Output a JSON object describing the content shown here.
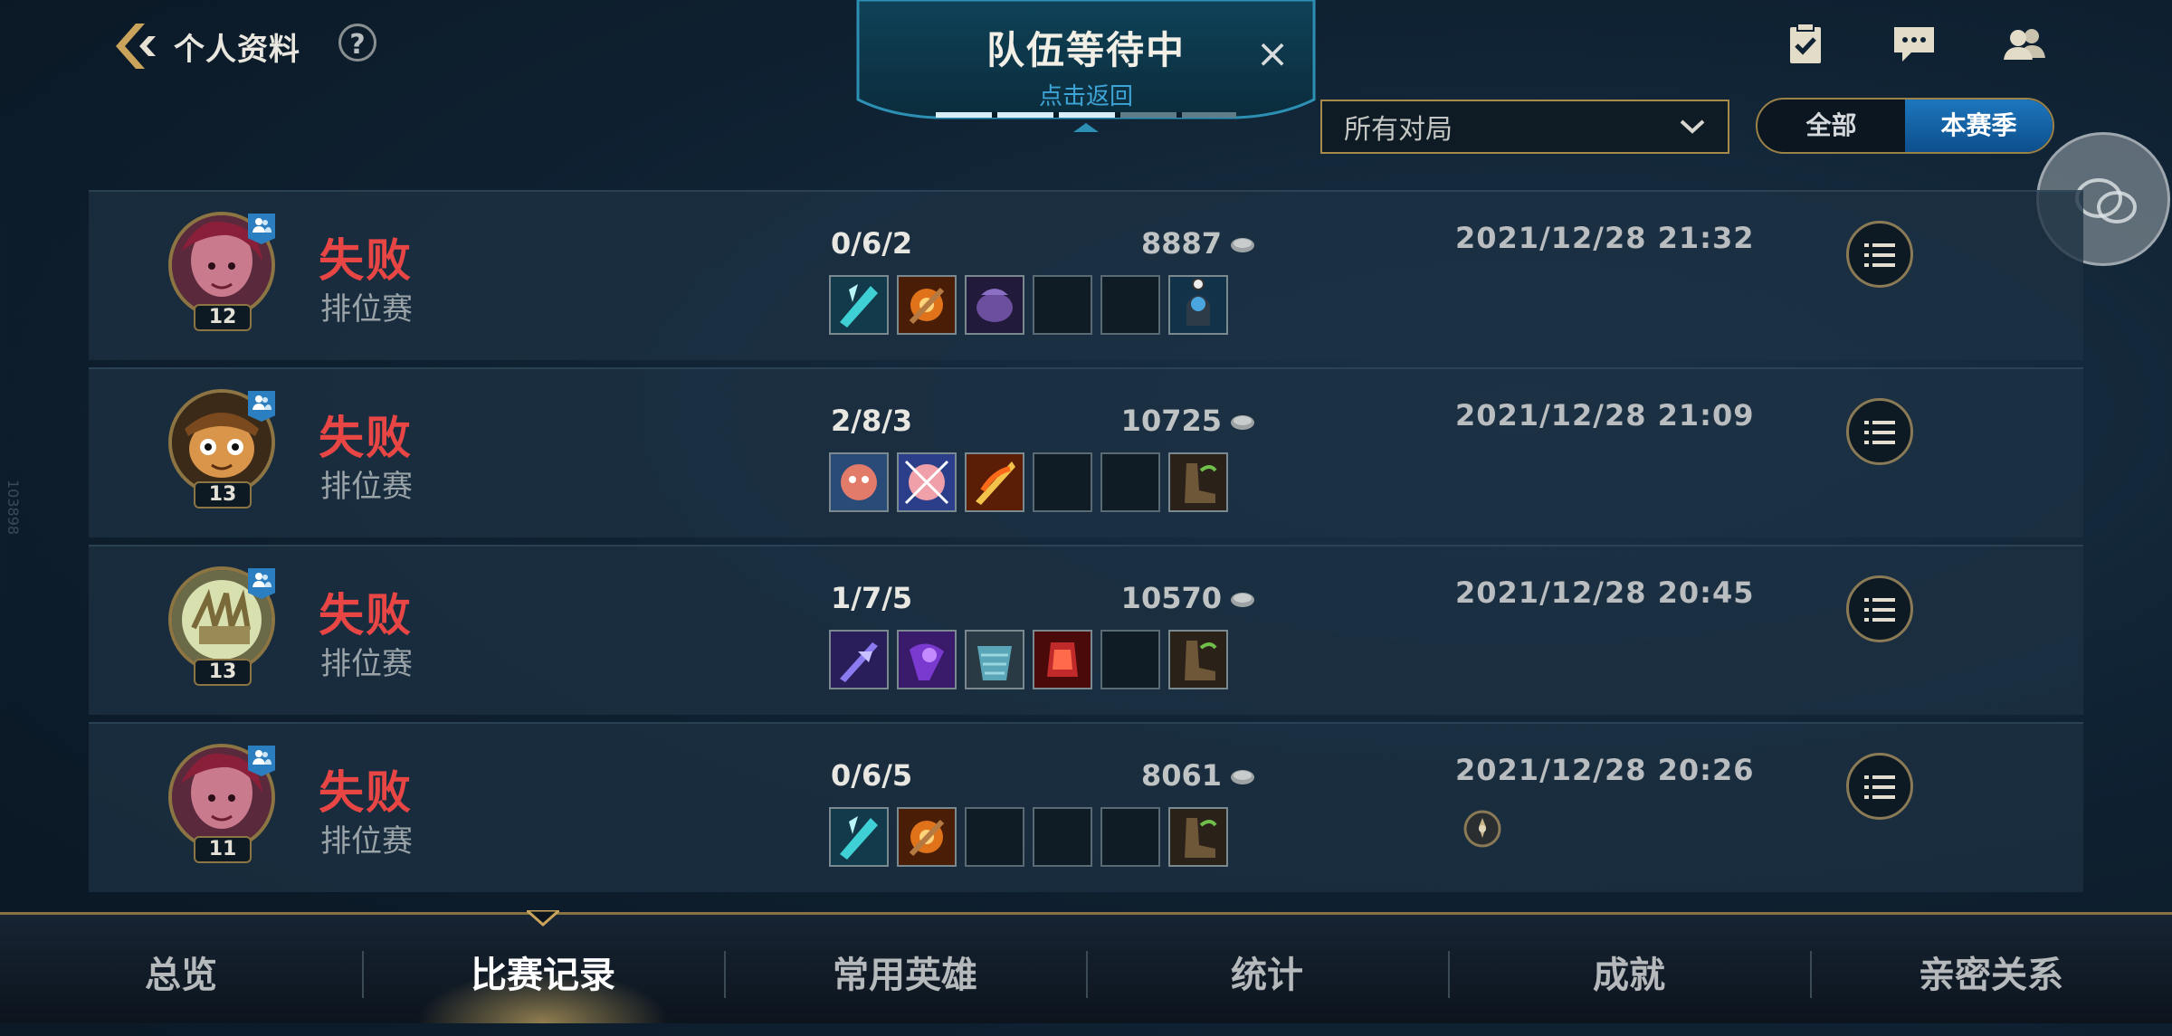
{
  "header": {
    "title": "个人资料",
    "help_icon": "?"
  },
  "queue_banner": {
    "title": "队伍等待中",
    "subtitle": "点击返回",
    "close_icon": "×"
  },
  "top_icons": [
    "missions-icon",
    "chat-icon",
    "friends-icon"
  ],
  "filter": {
    "selected": "所有对局"
  },
  "season_toggle": {
    "options": [
      "全部",
      "本赛季"
    ],
    "active": "本赛季"
  },
  "side_code": "103898",
  "colors": {
    "loss": "#e84545",
    "accent_gold": "#a88a4a",
    "active_blue": "#1d76bd"
  },
  "matches": [
    {
      "result": "失败",
      "mode": "排位赛",
      "level": "12",
      "kda": "0/6/2",
      "gold": "8887",
      "date": "2021/12/28 21:32",
      "champion": "xayah-like",
      "items_filled": 4
    },
    {
      "result": "失败",
      "mode": "排位赛",
      "level": "13",
      "kda": "2/8/3",
      "gold": "10725",
      "date": "2021/12/28 21:09",
      "champion": "teemo",
      "items_filled": 4
    },
    {
      "result": "失败",
      "mode": "排位赛",
      "level": "13",
      "kda": "1/7/5",
      "gold": "10570",
      "date": "2021/12/28 20:45",
      "champion": "gauntlet",
      "items_filled": 5
    },
    {
      "result": "失败",
      "mode": "排位赛",
      "level": "11",
      "kda": "0/6/5",
      "gold": "8061",
      "date": "2021/12/28 20:26",
      "champion": "xayah-like",
      "items_filled": 3
    }
  ],
  "nav": {
    "tabs": [
      "总览",
      "比赛记录",
      "常用英雄",
      "统计",
      "成就",
      "亲密关系"
    ],
    "active": "比赛记录"
  }
}
